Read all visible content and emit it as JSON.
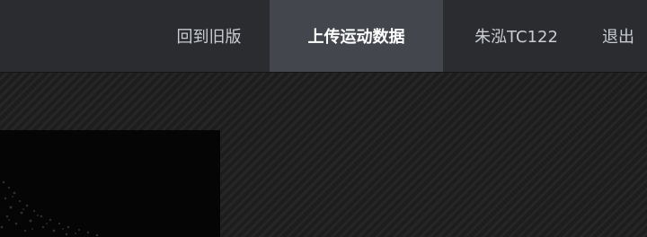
{
  "nav": {
    "items": [
      {
        "label": "回到旧版"
      },
      {
        "label": "上传运动数据"
      },
      {
        "label": "朱泓TC122"
      },
      {
        "label": "退出"
      }
    ],
    "active_index": 1
  },
  "colors": {
    "topbar": "#2a2c30",
    "active_tab": "#43474d",
    "nav_text": "#c9ccd1",
    "active_text": "#ffffff",
    "content_bg": "#1f1f1f"
  }
}
